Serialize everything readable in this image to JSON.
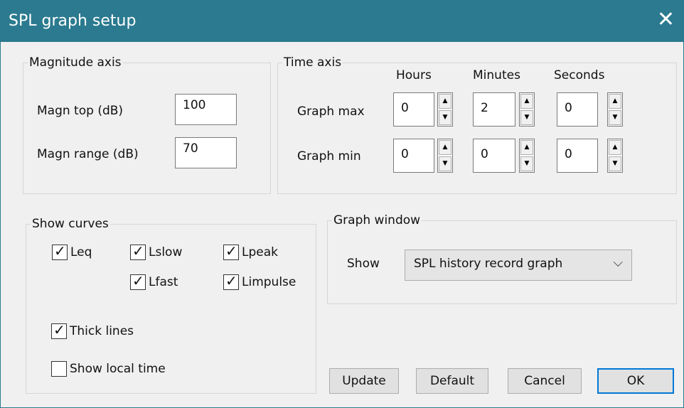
{
  "window": {
    "title": "SPL graph setup",
    "close_icon": "✕"
  },
  "magnitude": {
    "legend": "Magnitude axis",
    "top_label": "Magn top (dB)",
    "top_value": "100",
    "range_label": "Magn range (dB)",
    "range_value": "70"
  },
  "time": {
    "legend": "Time axis",
    "col_hours": "Hours",
    "col_minutes": "Minutes",
    "col_seconds": "Seconds",
    "max_label": "Graph max",
    "min_label": "Graph min",
    "max": {
      "hours": "0",
      "minutes": "2",
      "seconds": "0"
    },
    "min": {
      "hours": "0",
      "minutes": "0",
      "seconds": "0"
    }
  },
  "curves": {
    "legend": "Show curves",
    "leq": "Leq",
    "lslow": "Lslow",
    "lpeak": "Lpeak",
    "lfast": "Lfast",
    "limpulse": "Limpulse",
    "thick": "Thick lines",
    "local_time": "Show local time",
    "checked": {
      "leq": true,
      "lslow": true,
      "lpeak": true,
      "lfast": true,
      "limpulse": true,
      "thick": true,
      "local_time": false
    }
  },
  "graph_window": {
    "legend": "Graph window",
    "show_label": "Show",
    "selected": "SPL history record graph"
  },
  "buttons": {
    "update": "Update",
    "default": "Default",
    "cancel": "Cancel",
    "ok": "OK"
  },
  "glyphs": {
    "check": "✓",
    "up": "▲",
    "down": "▼",
    "chevron": "⌵"
  }
}
